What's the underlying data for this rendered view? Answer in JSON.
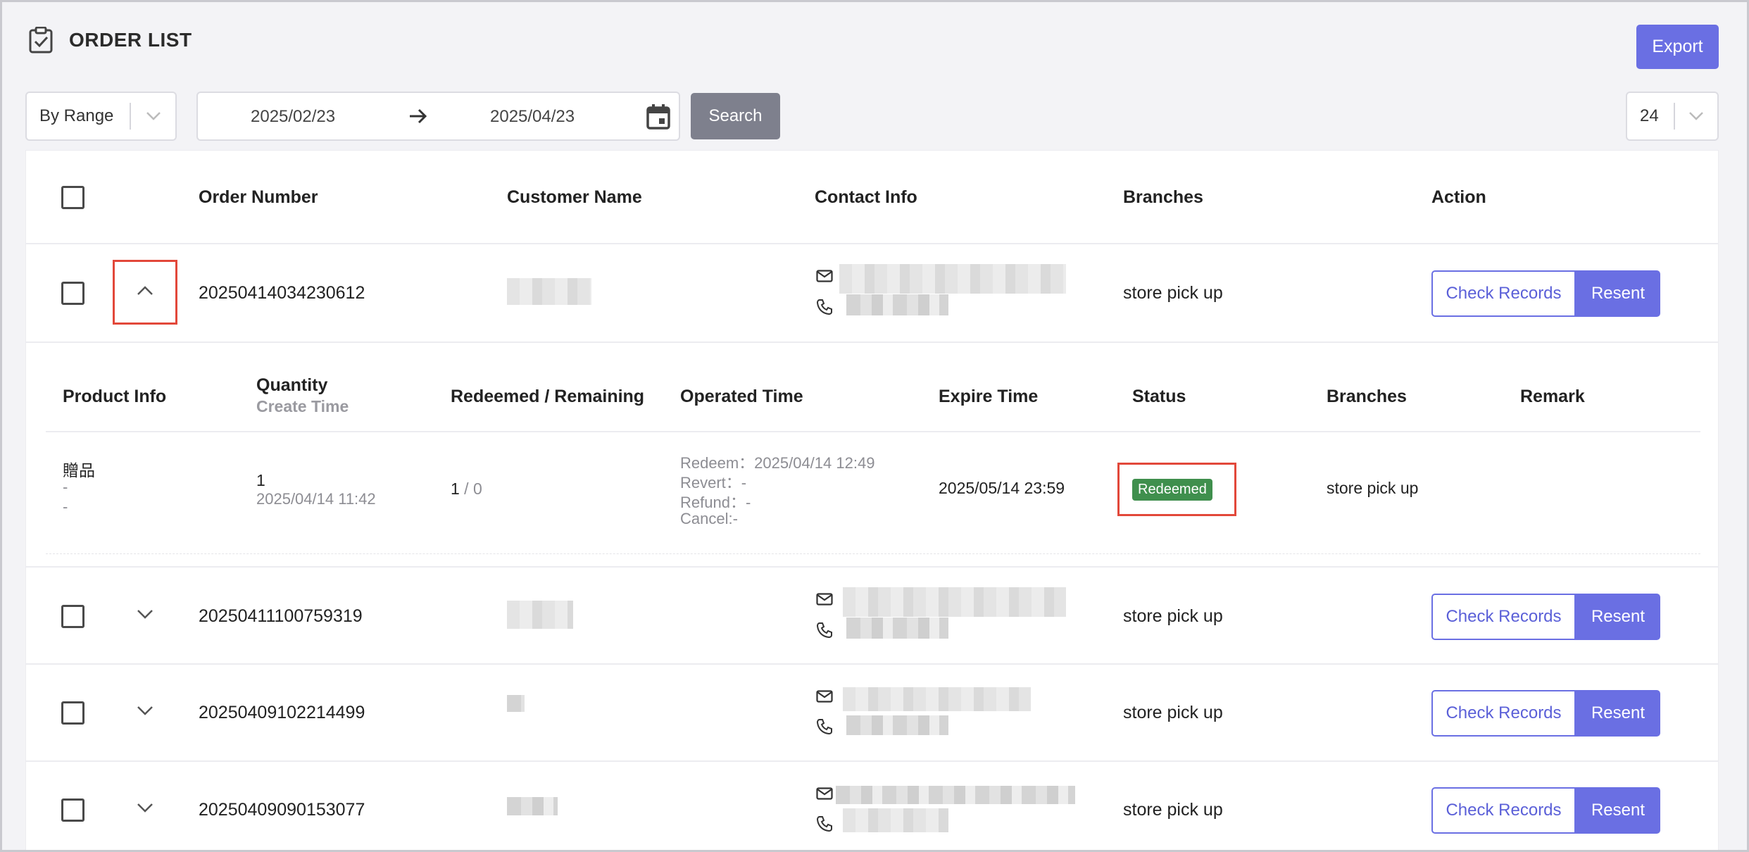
{
  "header": {
    "title": "ORDER LIST",
    "export_label": "Export"
  },
  "filters": {
    "range_mode": "By Range",
    "start_date": "2025/02/23",
    "end_date": "2025/04/23",
    "search_label": "Search",
    "page_size": "24"
  },
  "table": {
    "columns": {
      "order_number": "Order Number",
      "customer_name": "Customer Name",
      "contact_info": "Contact Info",
      "branches": "Branches",
      "action": "Action"
    },
    "rows": [
      {
        "order_number": "20250414034230612",
        "branch": "store pick up",
        "check_label": "Check Records",
        "resent_label": "Resent",
        "expanded": true
      },
      {
        "order_number": "20250411100759319",
        "branch": "store pick up",
        "check_label": "Check Records",
        "resent_label": "Resent",
        "expanded": false
      },
      {
        "order_number": "20250409102214499",
        "branch": "store pick up",
        "check_label": "Check Records",
        "resent_label": "Resent",
        "expanded": false
      },
      {
        "order_number": "20250409090153077",
        "branch": "store pick up",
        "check_label": "Check Records",
        "resent_label": "Resent",
        "expanded": false
      }
    ]
  },
  "detail": {
    "columns": {
      "product_info": "Product Info",
      "quantity": "Quantity",
      "create_time": "Create Time",
      "redeemed_remaining": "Redeemed / Remaining",
      "operated_time": "Operated Time",
      "expire_time": "Expire Time",
      "status": "Status",
      "branches": "Branches",
      "remark": "Remark"
    },
    "item": {
      "product_name": "贈品",
      "product_line2": "-",
      "product_line3": "-",
      "quantity": "1",
      "create_time": "2025/04/14 11:42",
      "redeemed": "1",
      "remaining": " / 0",
      "op_redeem": "Redeem：2025/04/14 12:49",
      "op_revert": "Revert：-",
      "op_refund": "Refund：-",
      "op_cancel": "Cancel:-",
      "expire_time": "2025/05/14 23:59",
      "status": "Redeemed",
      "branch": "store pick up"
    }
  },
  "colors": {
    "accent": "#6a6fe3",
    "status_redeemed": "#3f8f4d",
    "highlight": "#e2483a",
    "search_button": "#7e808d"
  },
  "icons": [
    "clipboard-check-icon",
    "chevron-down-icon",
    "arrow-right-icon",
    "calendar-icon",
    "chevron-up-icon",
    "mail-icon",
    "phone-icon"
  ]
}
